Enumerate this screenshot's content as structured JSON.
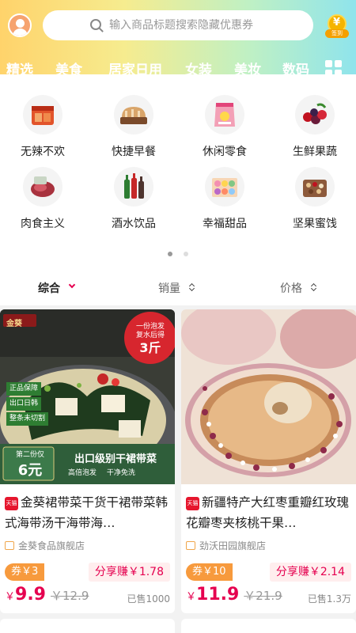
{
  "header": {
    "search_placeholder": "输入商品标题搜索隐藏优惠券",
    "coin_label": "签到",
    "accent_gradient": [
      "#ffd36b",
      "#f6ec8f",
      "#bff0c4",
      "#8fe4ec"
    ]
  },
  "tabs": [
    "精选",
    "美食",
    "居家日用",
    "女装",
    "美妆",
    "数码"
  ],
  "categories": [
    {
      "label": "无辣不欢",
      "icon": "spicy-meat-icon"
    },
    {
      "label": "快捷早餐",
      "icon": "bread-icon"
    },
    {
      "label": "休闲零食",
      "icon": "snack-bag-icon"
    },
    {
      "label": "生鲜果蔬",
      "icon": "berries-icon"
    },
    {
      "label": "肉食主义",
      "icon": "meat-icon"
    },
    {
      "label": "酒水饮品",
      "icon": "bottles-icon"
    },
    {
      "label": "幸福甜品",
      "icon": "macaron-box-icon"
    },
    {
      "label": "坚果蜜饯",
      "icon": "nuts-icon"
    }
  ],
  "carousel": {
    "pages": 2,
    "current": 1
  },
  "sort": {
    "comprehensive": "综合",
    "sales": "销量",
    "price": "价格",
    "active_color": "#e5004f"
  },
  "products": [
    {
      "platform": "天猫",
      "title": "金葵裙带菜干货干裙带菜韩式海带汤干海带海…",
      "store": "金葵食品旗舰店",
      "coupon": "券￥3",
      "share": "分享赚￥1.78",
      "currency": "￥",
      "price": "9.9",
      "original_price": "￥12.9",
      "sold": "已售1000",
      "image_text": {
        "brand": "金葵",
        "badge_line1": "一份泡发",
        "badge_line2": "复水后得",
        "badge_big": "3斤",
        "tags": [
          "正品保障",
          "出口日韩",
          "整条未切割"
        ],
        "promo_small": "第二份仅",
        "promo_price": "6元",
        "promo_title": "出口级别干裙带菜",
        "promo_sub1": "高倍泡发",
        "promo_sub2": "干净免洗"
      }
    },
    {
      "platform": "天猫",
      "title": "新疆特产大红枣重瓣红玫瑰花瓣枣夹核桃干果…",
      "store": "劲沃田园旗舰店",
      "coupon": "券￥10",
      "share": "分享赚￥2.14",
      "currency": "￥",
      "price": "11.9",
      "original_price": "￥21.9",
      "sold": "已售1.3万"
    }
  ]
}
